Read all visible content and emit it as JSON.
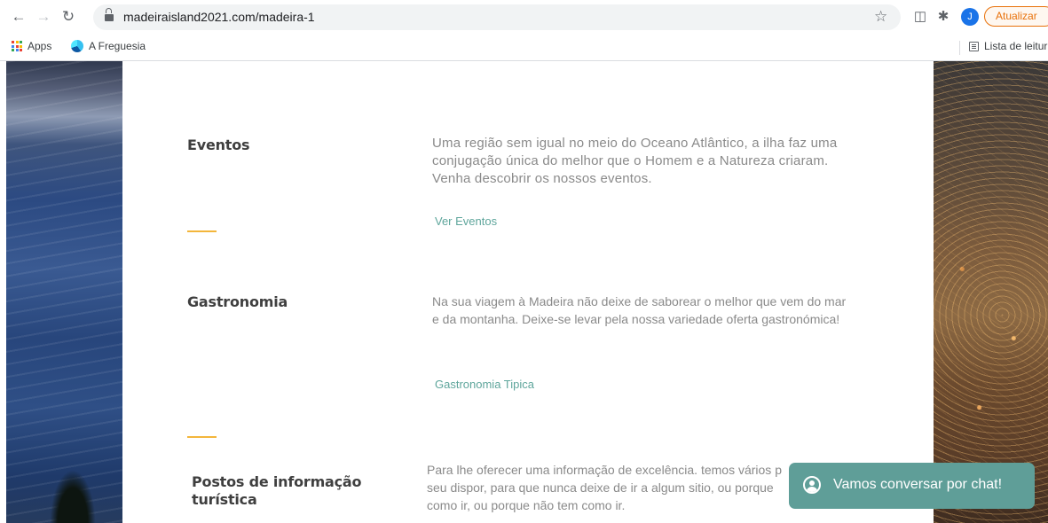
{
  "browser": {
    "url": "madeiraisland2021.com/madeira-1",
    "update_label": "Atualizar",
    "profile_initial": "J",
    "bookmarks": [
      {
        "label": "Apps",
        "icon": "apps-grid-icon"
      },
      {
        "label": "A Freguesia",
        "icon": "edge-icon"
      }
    ],
    "reading_list_label": "Lista de leitur"
  },
  "sections": [
    {
      "title": "Eventos",
      "text": "Uma região sem igual no meio do Oceano Atlântico, a ilha faz uma conjugação única do melhor que o Homem e a Natureza criaram. Venha descobrir os nossos eventos.",
      "link": "Ver Eventos"
    },
    {
      "title": "Gastronomia",
      "text": "Na sua viagem à Madeira não deixe de saborear o melhor que vem do mar e da montanha. Deixe-se levar pela nossa variedade oferta gastronómica!",
      "link": "Gastronomia Tipica"
    },
    {
      "title": "Postos de informação turística",
      "text": "Para lhe oferecer uma informação de excelência. temos vários p seu dispor, para que nunca deixe de ir a algum sitio, ou porque como ir, ou porque não tem como ir."
    }
  ],
  "chat": {
    "label": "Vamos conversar por chat!"
  },
  "colors": {
    "accent": "#f3b63b",
    "link": "#5fa69c",
    "chat_bg": "#5f9e98",
    "update": "#e8710a"
  }
}
